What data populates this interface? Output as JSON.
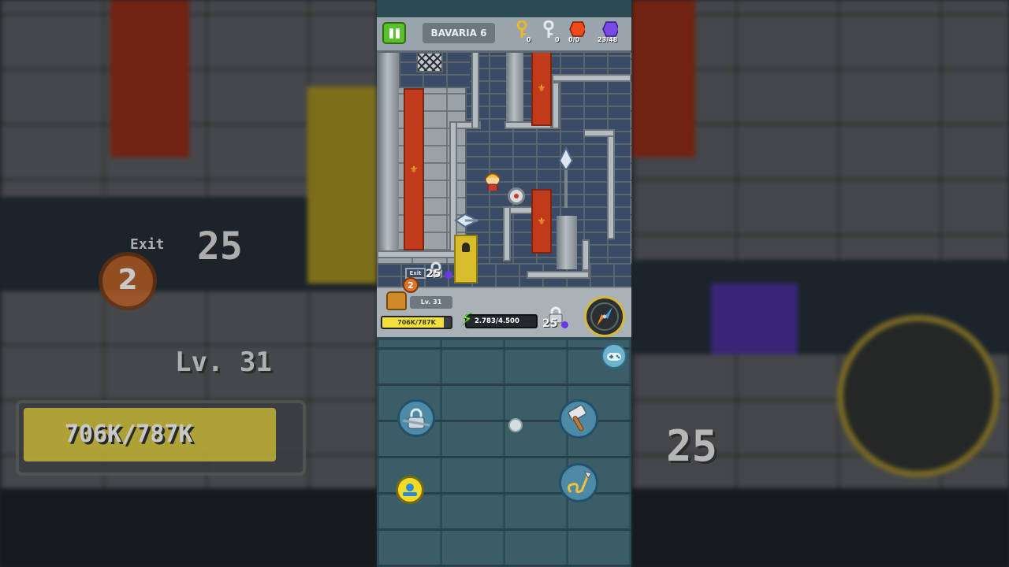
{
  "game": {
    "level_name": "BAVARIA 6",
    "stats": {
      "gold_keys": "0",
      "silver_keys": "0",
      "red_gems": "0/0",
      "purple_gems": "23/48"
    },
    "world": {
      "exit_label": "Exit",
      "exit_cost": "25",
      "chest_badge": "2"
    },
    "hud": {
      "player_level": "Lv. 31",
      "xp_text": "706K/787K",
      "xp_fraction": 0.897,
      "energy_text": "2.783/4.500",
      "lock_cost": "25"
    },
    "background": {
      "exit_label": "Exit",
      "exit_cost": "25",
      "chest_badge": "2",
      "player_level": "Lv. 31",
      "xp_text": "706K/787K",
      "lock_cost": "25"
    },
    "controls": {
      "buttons": [
        "gamepad-icon",
        "chain-lock-icon",
        "hammer-icon",
        "hook-icon",
        "joystick-icon"
      ]
    },
    "colors": {
      "accent_green": "#59c12b",
      "banner_red": "#c13a1a",
      "gem_purple": "#6a3ae0",
      "xp_yellow": "#f2e03a"
    }
  }
}
